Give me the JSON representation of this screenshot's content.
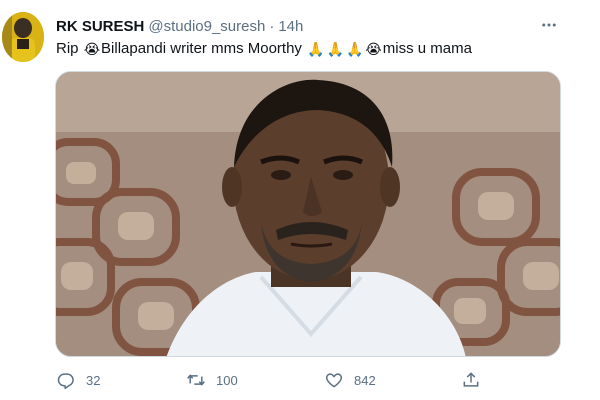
{
  "tweet": {
    "author_name": "RK SURESH",
    "author_handle": "@studio9_suresh",
    "separator": "·",
    "time": "14h",
    "text_parts": [
      "Rip ",
      "Billapandi writer mms Moorthy ",
      "miss u mama"
    ],
    "emojis": {
      "crying": "😭",
      "folded_hands": "🙏"
    }
  },
  "actions": {
    "reply_count": "32",
    "retweet_count": "100",
    "like_count": "842"
  },
  "icons": {
    "more": "more-icon",
    "reply": "reply-icon",
    "retweet": "retweet-icon",
    "like": "like-icon",
    "share": "share-icon"
  },
  "colors": {
    "secondary_text": "#5b7083",
    "primary_text": "#0f1419",
    "border": "#cfd9de"
  }
}
